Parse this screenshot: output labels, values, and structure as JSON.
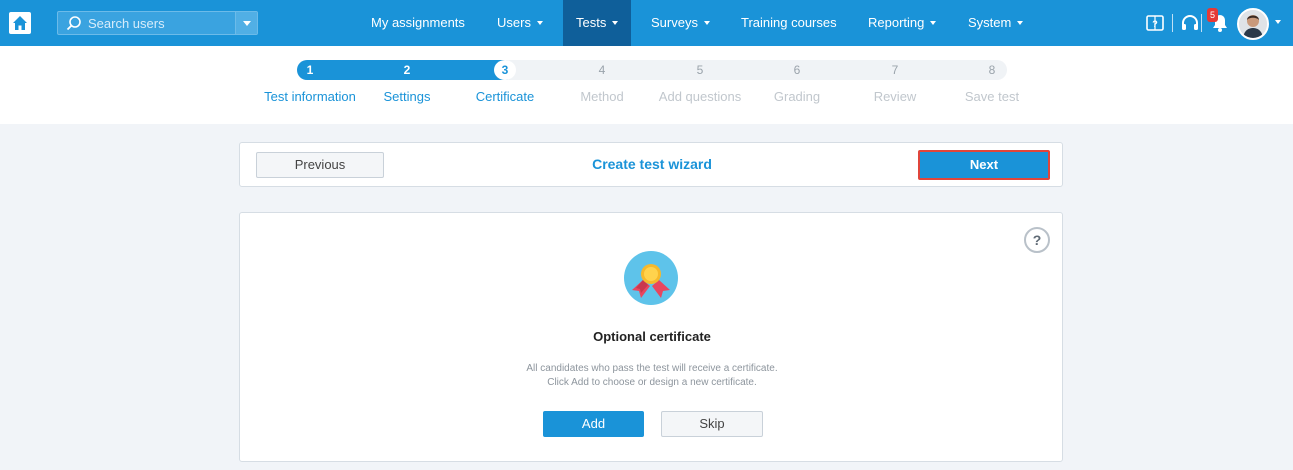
{
  "nav": {
    "home_icon": "home-icon",
    "search_placeholder": "Search users",
    "menu": [
      {
        "label": "My assignments",
        "dropdown": false
      },
      {
        "label": "Users",
        "dropdown": true
      },
      {
        "label": "Tests",
        "dropdown": true,
        "active": true
      },
      {
        "label": "Surveys",
        "dropdown": true
      },
      {
        "label": "Training courses",
        "dropdown": false
      },
      {
        "label": "Reporting",
        "dropdown": true
      },
      {
        "label": "System",
        "dropdown": true
      }
    ],
    "notification_count": "5",
    "icons": [
      "help-book-icon",
      "headset-icon",
      "bell-icon",
      "avatar"
    ]
  },
  "steps": [
    {
      "num": "1",
      "label": "Test information",
      "state": "done"
    },
    {
      "num": "2",
      "label": "Settings",
      "state": "done"
    },
    {
      "num": "3",
      "label": "Certificate",
      "state": "current"
    },
    {
      "num": "4",
      "label": "Method",
      "state": "todo"
    },
    {
      "num": "5",
      "label": "Add questions",
      "state": "todo"
    },
    {
      "num": "6",
      "label": "Grading",
      "state": "todo"
    },
    {
      "num": "7",
      "label": "Review",
      "state": "todo"
    },
    {
      "num": "8",
      "label": "Save test",
      "state": "todo"
    }
  ],
  "wizard": {
    "previous_label": "Previous",
    "title": "Create test wizard",
    "next_label": "Next"
  },
  "certificate": {
    "help_label": "?",
    "title": "Optional certificate",
    "description_lines": [
      "All candidates who pass the test will receive a certificate.",
      "Click Add to choose or design a new certificate."
    ],
    "add_label": "Add",
    "skip_label": "Skip"
  },
  "colors": {
    "primary": "#1a93d8",
    "nav_active": "#0f5f9a",
    "highlight_border": "#e0453b",
    "page_bg": "#f1f4f8"
  }
}
